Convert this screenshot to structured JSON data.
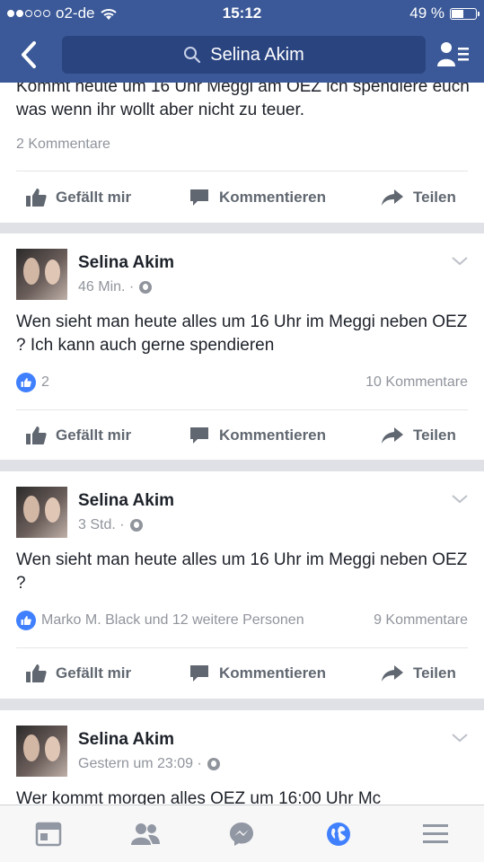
{
  "status": {
    "carrier": "o2-de",
    "time": "15:12",
    "battery": "49 %",
    "battery_level": 0.49
  },
  "nav": {
    "search_text": "Selina Akim"
  },
  "post0": {
    "text": "Kommt heute um 16 Uhr Meggi am OEZ ich spendiere euch was wenn ihr wollt aber nicht zu teuer.",
    "comments": "2 Kommentare"
  },
  "post1": {
    "name": "Selina Akim",
    "time": "46 Min. ·",
    "text": "Wen sieht man heute alles um 16 Uhr im Meggi neben OEZ ? Ich kann auch gerne spendieren",
    "likes": "2",
    "comments": "10 Kommentare"
  },
  "post2": {
    "name": "Selina Akim",
    "time": "3 Std. ·",
    "text": "Wen sieht man heute alles um 16 Uhr im Meggi neben OEZ ?",
    "likes": "Marko M. Black und 12 weitere Personen",
    "comments": "9 Kommentare"
  },
  "post3": {
    "name": "Selina Akim",
    "time": "Gestern um 23:09 ·",
    "text": "Wer kommt morgen alles OEZ um 16:00 Uhr Mc"
  },
  "actions": {
    "like": "Gefällt mir",
    "comment": "Kommentieren",
    "share": "Teilen"
  },
  "colors": {
    "brand": "#3b5998",
    "like_blue": "#4080ff",
    "active_tab": "#4080ff"
  }
}
